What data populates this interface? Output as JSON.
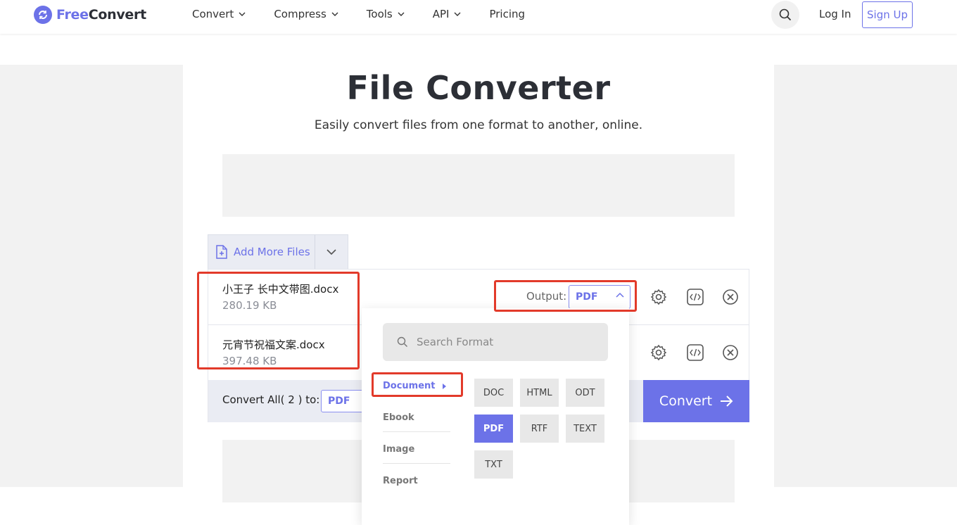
{
  "header": {
    "logo_free": "Free",
    "logo_convert": "Convert",
    "nav": [
      {
        "label": "Convert"
      },
      {
        "label": "Compress"
      },
      {
        "label": "Tools"
      },
      {
        "label": "API"
      },
      {
        "label": "Pricing"
      }
    ],
    "login": "Log In",
    "signup": "Sign Up"
  },
  "hero": {
    "title": "File Converter",
    "subtitle": "Easily convert files from one format to another, online."
  },
  "add_more": {
    "label": "Add More Files"
  },
  "files": [
    {
      "name": "小王子 长中文带图.docx",
      "size": "280.19 KB"
    },
    {
      "name": "元宵节祝福文案.docx",
      "size": "397.48 KB"
    }
  ],
  "output": {
    "label": "Output:",
    "value": "PDF"
  },
  "convert_all": {
    "label": "Convert All( 2 ) to:",
    "value": "PDF"
  },
  "convert_button": "Convert",
  "dropdown": {
    "search_placeholder": "Search Format",
    "categories": [
      "Document",
      "Ebook",
      "Image",
      "Report"
    ],
    "formats": [
      "DOC",
      "HTML",
      "ODT",
      "PDF",
      "RTF",
      "TEXT",
      "TXT"
    ],
    "selected_format": "PDF",
    "active_category": "Document"
  },
  "colors": {
    "accent": "#6c72e8",
    "annotation": "#e23a2a"
  }
}
